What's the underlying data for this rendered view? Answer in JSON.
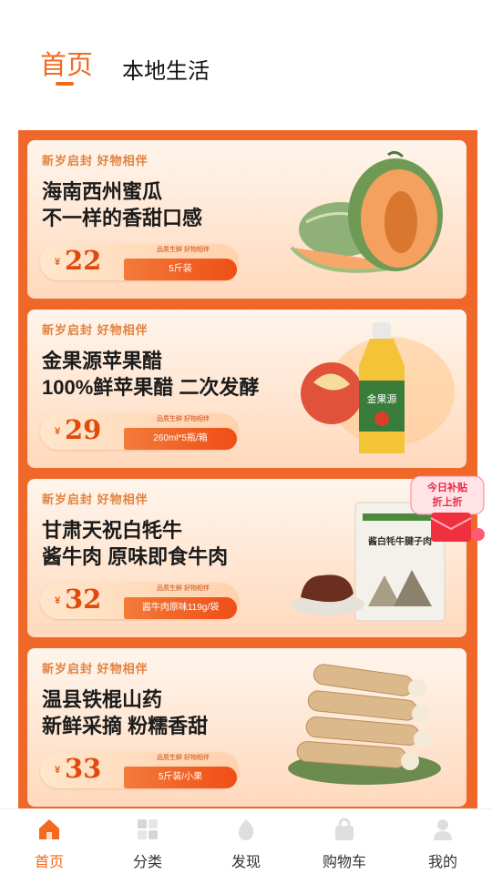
{
  "top_tabs": {
    "active": "首页",
    "second": "本地生活"
  },
  "cards": [
    {
      "tagline": "新岁启封 好物相伴",
      "title1": "海南西州蜜瓜",
      "title2": "不一样的香甜口感",
      "yen": "¥",
      "price": "22",
      "mini": "品质生鲜 好物相伴",
      "spec": "5斤装"
    },
    {
      "tagline": "新岁启封 好物相伴",
      "title1": "金果源苹果醋",
      "title2": "100%鲜苹果醋 二次发酵",
      "yen": "¥",
      "price": "29",
      "mini": "品质生鲜 好物相伴",
      "spec": "260ml*5瓶/箱"
    },
    {
      "tagline": "新岁启封 好物相伴",
      "title1": "甘肃天祝白牦牛",
      "title2": "酱牛肉 原味即食牛肉",
      "yen": "¥",
      "price": "32",
      "mini": "品质生鲜 好物相伴",
      "spec": "酱牛肉原味119g/袋"
    },
    {
      "tagline": "新岁启封 好物相伴",
      "title1": "温县铁棍山药",
      "title2": "新鲜采摘 粉糯香甜",
      "yen": "¥",
      "price": "33",
      "mini": "品质生鲜 好物相伴",
      "spec": "5斤装/小果"
    }
  ],
  "product_labels": {
    "vinegar_brand": "金果源",
    "beef_pack": "酱白牦牛腱子肉"
  },
  "coupon": {
    "line1": "今日补贴",
    "line2": "折上折"
  },
  "bottom_nav": [
    {
      "label": "首页",
      "icon": "home-icon"
    },
    {
      "label": "分类",
      "icon": "category-icon"
    },
    {
      "label": "发现",
      "icon": "discover-icon"
    },
    {
      "label": "购物车",
      "icon": "cart-icon"
    },
    {
      "label": "我的",
      "icon": "profile-icon"
    }
  ],
  "colors": {
    "accent": "#f26a1e",
    "panel": "#f0672a",
    "price": "#e24a0c"
  }
}
